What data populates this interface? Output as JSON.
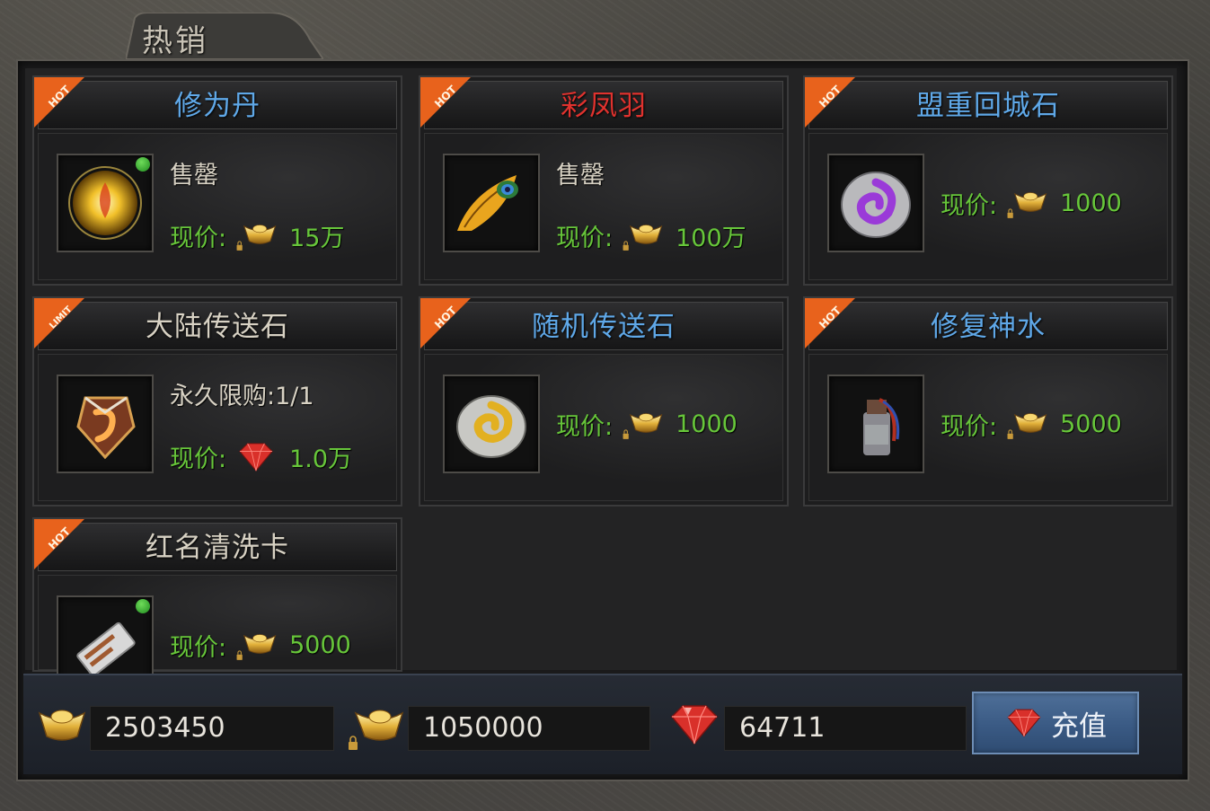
{
  "panel": {
    "title": "热销"
  },
  "items": [
    {
      "name": "修为丹",
      "name_color": "#5fa8e8",
      "ribbon": "HOT",
      "line1": "售罄",
      "price_label": "现价:",
      "currency": "locked-gold-ingot-icon",
      "price": "15万",
      "has_dot": true,
      "icon": "golden-orb-icon"
    },
    {
      "name": "彩凤羽",
      "name_color": "#e0322e",
      "ribbon": "HOT",
      "line1": "售罄",
      "price_label": "现价:",
      "currency": "locked-gold-ingot-icon",
      "price": "100万",
      "has_dot": false,
      "icon": "phoenix-feather-icon"
    },
    {
      "name": "盟重回城石",
      "name_color": "#5fa8e8",
      "ribbon": "HOT",
      "line1": "",
      "price_label": "现价:",
      "currency": "locked-gold-ingot-icon",
      "price": "1000",
      "has_dot": false,
      "icon": "purple-stone-icon"
    },
    {
      "name": "大陆传送石",
      "name_color": "#d8d2c4",
      "ribbon": "LIMIT",
      "line1": "永久限购:1/1",
      "price_label": "现价:",
      "currency": "ruby-gem-icon",
      "price": "1.0万",
      "has_dot": false,
      "icon": "shield-rune-icon"
    },
    {
      "name": "随机传送石",
      "name_color": "#5fa8e8",
      "ribbon": "HOT",
      "line1": "",
      "price_label": "现价:",
      "currency": "locked-gold-ingot-icon",
      "price": "1000",
      "has_dot": false,
      "icon": "gold-stone-icon"
    },
    {
      "name": "修复神水",
      "name_color": "#5fa8e8",
      "ribbon": "HOT",
      "line1": "",
      "price_label": "现价:",
      "currency": "locked-gold-ingot-icon",
      "price": "5000",
      "has_dot": false,
      "icon": "potion-bottle-icon"
    },
    {
      "name": "红名清洗卡",
      "name_color": "#d8d2c4",
      "ribbon": "HOT",
      "line1": "",
      "price_label": "现价:",
      "currency": "locked-gold-ingot-icon",
      "price": "5000",
      "has_dot": true,
      "icon": "card-icon"
    }
  ],
  "wallet": {
    "gold": "2503450",
    "bound_gold": "1050000",
    "gems": "64711",
    "recharge_label": "充值"
  },
  "colors": {
    "price_green": "#67c63a",
    "ribbon_orange": "#e8621c"
  }
}
